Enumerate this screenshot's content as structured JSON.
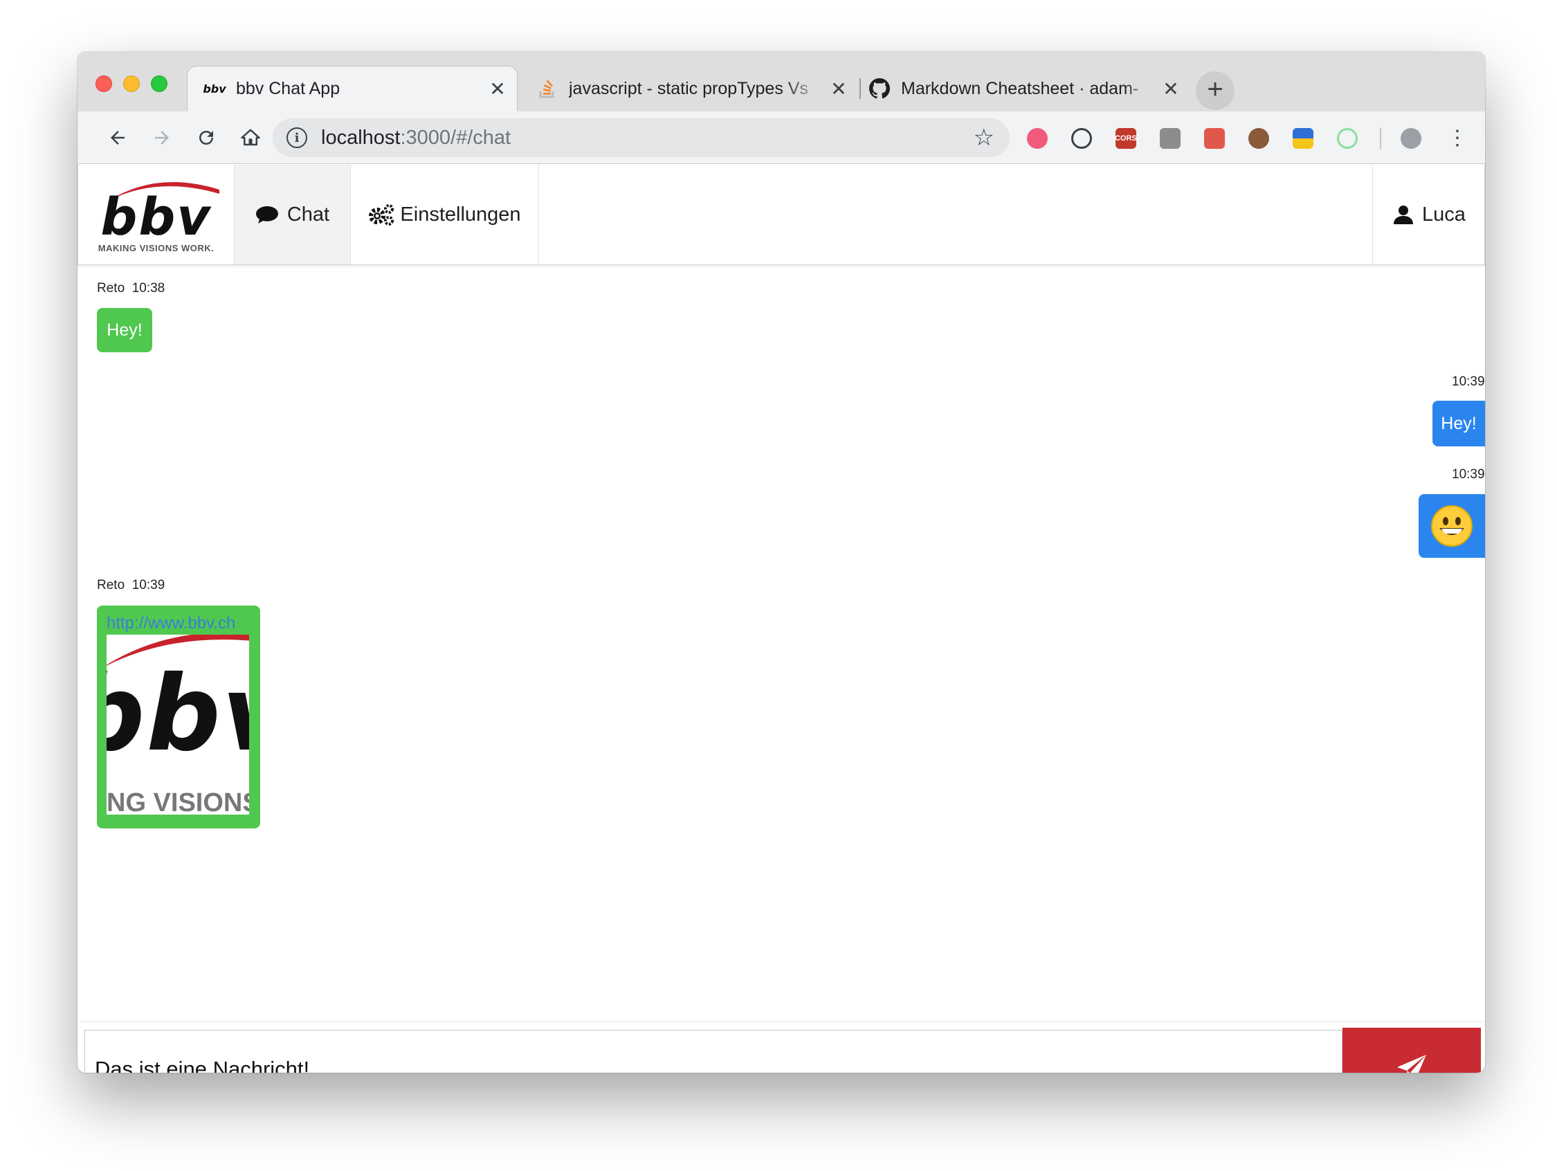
{
  "browser": {
    "tabs": [
      {
        "title": "bbv Chat App",
        "favicon": "bbv-logo-icon",
        "active": true
      },
      {
        "title": "javascript - static propTypes Vs",
        "favicon": "stackoverflow-icon",
        "active": false
      },
      {
        "title": "Markdown Cheatsheet · adam-",
        "favicon": "github-icon",
        "active": false
      }
    ],
    "new_tab": "+",
    "url_host": "localhost",
    "url_rest": ":3000/#/chat",
    "extensions": [
      "ext-red-icon",
      "ext-1password-icon",
      "cors-icon",
      "ext-gray-icon",
      "ext-bug-icon",
      "cookie-icon",
      "lighthouse-icon",
      "ext-green-icon"
    ]
  },
  "app": {
    "logo_text": "bbv",
    "logo_tagline": "MAKING VISIONS WORK.",
    "nav": {
      "chat": "Chat",
      "settings": "Einstellungen",
      "user": "Luca"
    },
    "colors": {
      "incoming": "#50c850",
      "outgoing": "#2a86ee",
      "send": "#c92b33"
    },
    "messages": [
      {
        "author": "Reto",
        "time": "10:38",
        "text": "Hey!",
        "side": "left"
      },
      {
        "author": "",
        "time": "10:39",
        "text": "Hey!",
        "side": "right"
      },
      {
        "author": "",
        "time": "10:39",
        "text": "😀",
        "side": "right"
      },
      {
        "author": "Reto",
        "time": "10:39",
        "link": "http://www.bbv.ch",
        "preview_text": "bbv",
        "preview_caption": "NG VISIONS",
        "side": "left"
      }
    ],
    "composer": {
      "value": "Das ist eine Nachricht!"
    }
  }
}
